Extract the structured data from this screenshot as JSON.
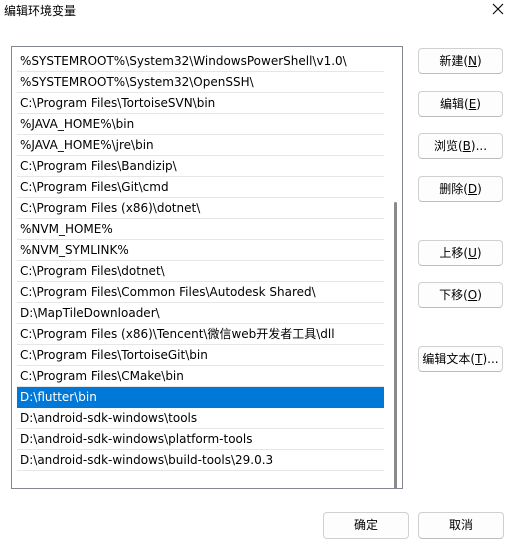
{
  "window": {
    "title": "编辑环境变量",
    "close_icon": "close-icon"
  },
  "path_list": {
    "selected_index": 16,
    "items": [
      "%SYSTEMROOT%\\System32\\WindowsPowerShell\\v1.0\\",
      "%SYSTEMROOT%\\System32\\OpenSSH\\",
      "C:\\Program Files\\TortoiseSVN\\bin",
      "%JAVA_HOME%\\bin",
      "%JAVA_HOME%\\jre\\bin",
      "C:\\Program Files\\Bandizip\\",
      "C:\\Program Files\\Git\\cmd",
      "C:\\Program Files (x86)\\dotnet\\",
      "%NVM_HOME%",
      "%NVM_SYMLINK%",
      "C:\\Program Files\\dotnet\\",
      "C:\\Program Files\\Common Files\\Autodesk Shared\\",
      "D:\\MapTileDownloader\\",
      "C:\\Program Files (x86)\\Tencent\\微信web开发者工具\\dll",
      "C:\\Program Files\\TortoiseGit\\bin",
      "C:\\Program Files\\CMake\\bin",
      "D:\\flutter\\bin",
      "D:\\android-sdk-windows\\tools",
      "D:\\android-sdk-windows\\platform-tools",
      "D:\\android-sdk-windows\\build-tools\\29.0.3"
    ]
  },
  "buttons": {
    "new": {
      "label": "新建(",
      "key": "N",
      "suffix": ")"
    },
    "edit": {
      "label": "编辑(",
      "key": "E",
      "suffix": ")"
    },
    "browse": {
      "label": "浏览(",
      "key": "B",
      "suffix": ")..."
    },
    "delete": {
      "label": "删除(",
      "key": "D",
      "suffix": ")"
    },
    "move_up": {
      "label": "上移(",
      "key": "U",
      "suffix": ")"
    },
    "move_down": {
      "label": "下移(",
      "key": "O",
      "suffix": ")"
    },
    "edit_text": {
      "label": "编辑文本(",
      "key": "T",
      "suffix": ")..."
    },
    "ok": "确定",
    "cancel": "取消"
  },
  "colors": {
    "selection": "#0078d7",
    "list_border": "#828790"
  }
}
